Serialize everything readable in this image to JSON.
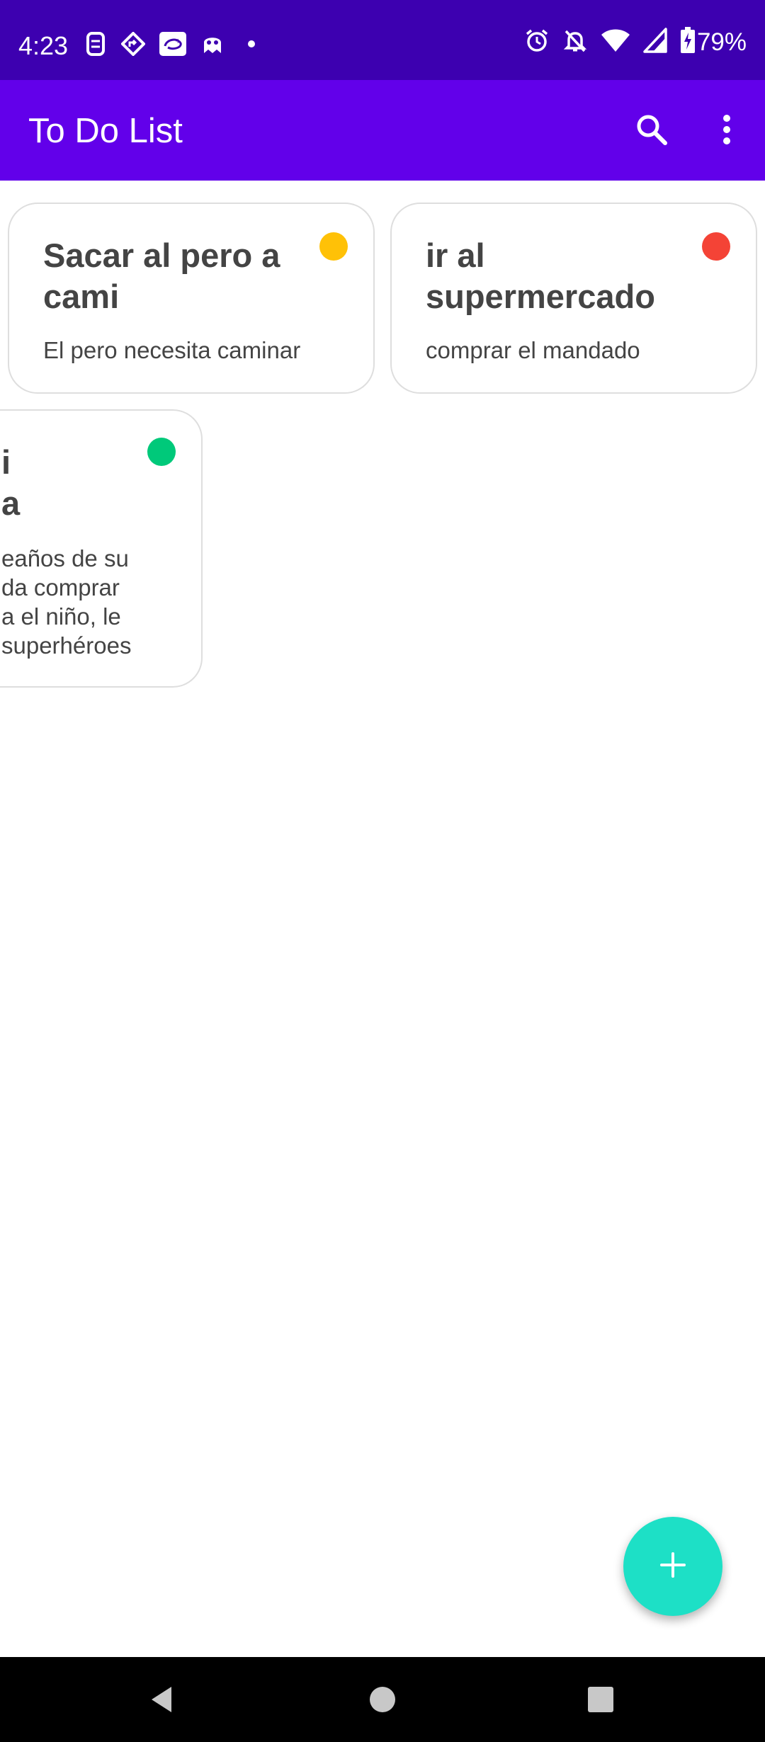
{
  "status_bar": {
    "time": "4:23",
    "battery": "79%",
    "left_icons": [
      "sim-icon",
      "maps-icon",
      "disney-plus-icon",
      "ghost-icon",
      "dot-icon"
    ],
    "right_icons": [
      "alarm-icon",
      "notifications-off-icon",
      "wifi-icon",
      "signal-icon",
      "battery-charging-icon"
    ],
    "color": "#3d00b0"
  },
  "app_bar": {
    "title": "To Do List",
    "search_icon": "search-icon",
    "menu_icon": "more-vert-icon",
    "color": "#6200ea"
  },
  "notes": [
    {
      "title_lines": [
        "Sacar al pero a",
        "cami"
      ],
      "description_lines": [
        "El pero necesita caminar"
      ],
      "priority_color": "#ffc107"
    },
    {
      "title_lines": [
        "ir al",
        "supermercado"
      ],
      "description_lines": [
        "comprar el mandado"
      ],
      "priority_color": "#f44336"
    },
    {
      "title_lines": [
        "i",
        "a"
      ],
      "description_lines": [
        "eaños de su",
        "da comprar",
        "a el niño, le",
        "superhéroes"
      ],
      "priority_color": "#00c97a"
    }
  ],
  "fab": {
    "icon": "add-icon",
    "color": "#1de0c6"
  },
  "nav_bar": {
    "icons": [
      "back-icon",
      "home-icon",
      "recents-icon"
    ]
  }
}
